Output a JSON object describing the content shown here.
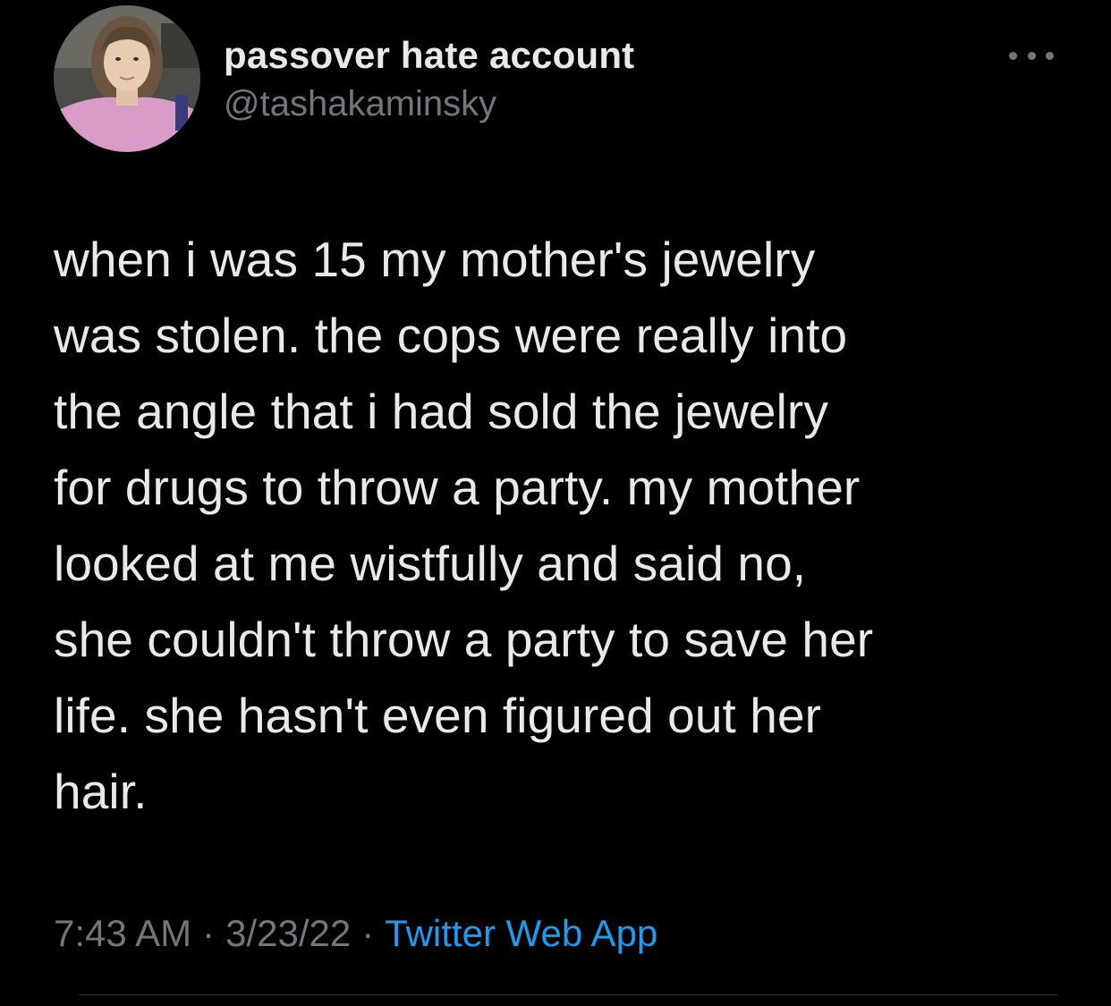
{
  "user": {
    "display_name": "passover hate account",
    "handle": "@tashakaminsky"
  },
  "menu": {
    "icon": "more-horizontal-icon"
  },
  "tweet": {
    "text": "when i was 15 my mother's jewelry\nwas stolen. the cops were really into\nthe angle that i had sold the jewelry\nfor drugs to throw a party. my mother\nlooked at me wistfully and said no,\nshe couldn't throw a party to save her\nlife. she hasn't even figured out her\nhair."
  },
  "meta": {
    "time": "7:43 AM",
    "separator": "·",
    "date": "3/23/22",
    "source": "Twitter Web App"
  },
  "colors": {
    "background": "#000000",
    "primary_text": "#e7e9ea",
    "secondary_text": "#71767b",
    "link": "#1d9bf0",
    "divider": "#2f3336"
  }
}
